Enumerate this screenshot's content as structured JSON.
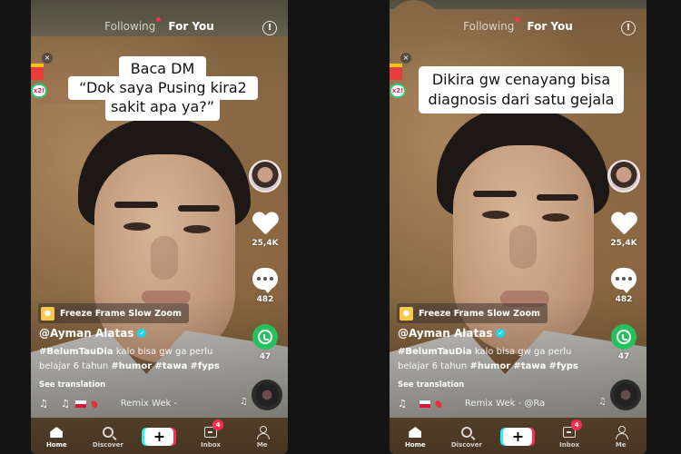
{
  "phones": [
    {
      "id": "left",
      "top_tabs": {
        "following": "Following",
        "for_you": "For You"
      },
      "caption_lines": [
        "Baca DM",
        "“Dok saya Pusing kira2",
        "sakit apa ya?”"
      ],
      "gift_badge": "x2!",
      "likes": "25,4K",
      "comments": "482",
      "shares": "47",
      "effect": "Freeze Frame Slow Zoom",
      "username": "@Ayman Alatas",
      "description": {
        "hashtag1": "#BelumTauDia",
        "text1": " kalo bisa gw ga perlu belajar 6 tahun ",
        "hashtag2": "#humor",
        "hashtag3": "#tawa",
        "hashtag4": "#fyps"
      },
      "see_translation": "See translation",
      "song": "Remix Wek - ",
      "nav": {
        "home": "Home",
        "discover": "Discover",
        "inbox": "Inbox",
        "me": "Me",
        "inbox_badge": "4",
        "create": "+"
      }
    },
    {
      "id": "right",
      "top_tabs": {
        "following": "Following",
        "for_you": "For You"
      },
      "caption_lines": [
        "Dikira gw cenayang bisa",
        "diagnosis dari satu gejala"
      ],
      "gift_badge": "x2!",
      "likes": "25,4K",
      "comments": "482",
      "shares": "47",
      "effect": "Freeze Frame Slow Zoom",
      "username": "@Ayman Alatas",
      "description": {
        "hashtag1": "#BelumTauDia",
        "text1": " kalo bisa gw ga perlu belajar 6 tahun ",
        "hashtag2": "#humor",
        "hashtag3": "#tawa",
        "hashtag4": "#fyps"
      },
      "see_translation": "See translation",
      "song": "Remix Wek - @Ra",
      "nav": {
        "home": "Home",
        "discover": "Discover",
        "inbox": "Inbox",
        "me": "Me",
        "inbox_badge": "4",
        "create": "+"
      }
    }
  ],
  "icons": {
    "info": "!",
    "close": "×",
    "verified": "✓",
    "music_note": "♫",
    "effect": "✹"
  },
  "colors": {
    "accent_red": "#fe2c55",
    "accent_cyan": "#25f4ee",
    "whatsapp_green": "#25c15f",
    "effect_yellow": "#f7c948"
  }
}
